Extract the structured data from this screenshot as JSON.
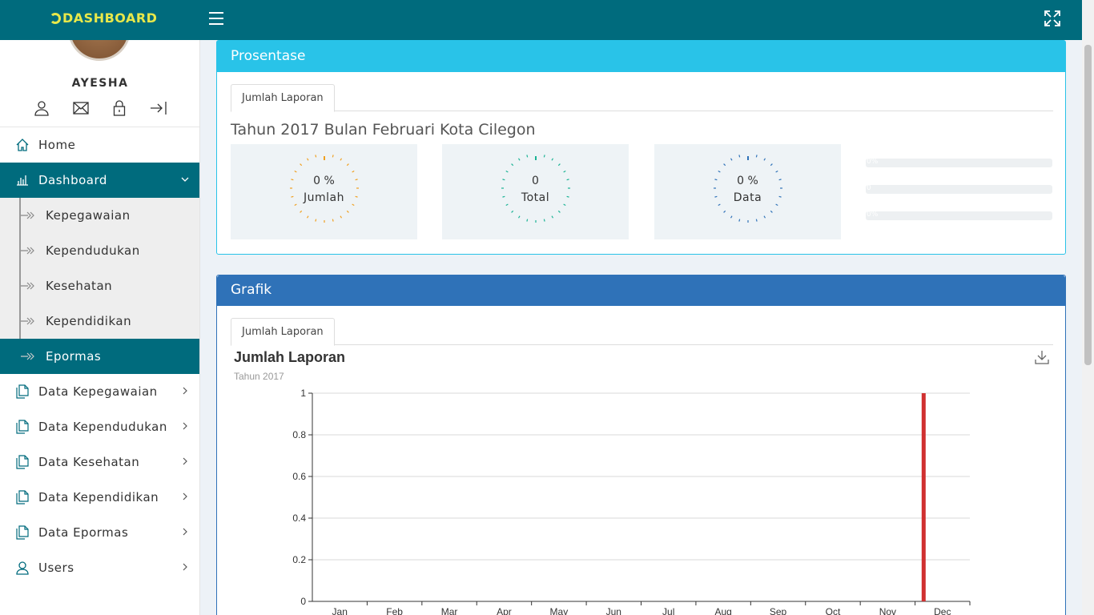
{
  "topbar": {
    "brand": "DASHBOARD"
  },
  "user": {
    "name": "AYESHA"
  },
  "menu": {
    "home": "Home",
    "dashboard": "Dashboard",
    "sub": [
      "Kepegawaian",
      "Kependudukan",
      "Kesehatan",
      "Kependidikan",
      "Epormas"
    ],
    "data_kepegawaian": "Data Kepegawaian",
    "data_kependudukan": "Data Kependudukan",
    "data_kesehatan": "Data Kesehatan",
    "data_kependidikan": "Data Kependidikan",
    "data_epormas": "Data Epormas",
    "users": "Users"
  },
  "prosentase": {
    "title": "Prosentase",
    "tab": "Jumlah Laporan",
    "heading": "Tahun 2017 Bulan Februari Kota Cilegon",
    "stats": [
      {
        "value": "0 %",
        "label": "Jumlah",
        "color": "#f0a020"
      },
      {
        "value": "0",
        "label": "Total",
        "color": "#1ab394"
      },
      {
        "value": "0 %",
        "label": "Data",
        "color": "#2f72b8"
      }
    ],
    "bars": [
      {
        "text": "0%",
        "fraction": 0
      },
      {
        "text": "0",
        "fraction": 0
      },
      {
        "text": "0%",
        "fraction": 0
      }
    ]
  },
  "grafik": {
    "title": "Grafik",
    "tab": "Jumlah Laporan"
  },
  "chart_data": {
    "type": "bar",
    "title": "Jumlah Laporan",
    "subtitle": "Tahun 2017",
    "categories": [
      "Jan",
      "Feb",
      "Mar",
      "Apr",
      "May",
      "Jun",
      "Jul",
      "Aug",
      "Sep",
      "Oct",
      "Nov",
      "Dec"
    ],
    "values": [
      0,
      0,
      0,
      0,
      0,
      0,
      0,
      0,
      0,
      0,
      0,
      1
    ],
    "ylim": [
      0,
      1
    ],
    "yticks": [
      "0",
      "0.2",
      "0.4",
      "0.6",
      "0.8",
      "1"
    ],
    "grid": true,
    "color": "#d03030"
  }
}
